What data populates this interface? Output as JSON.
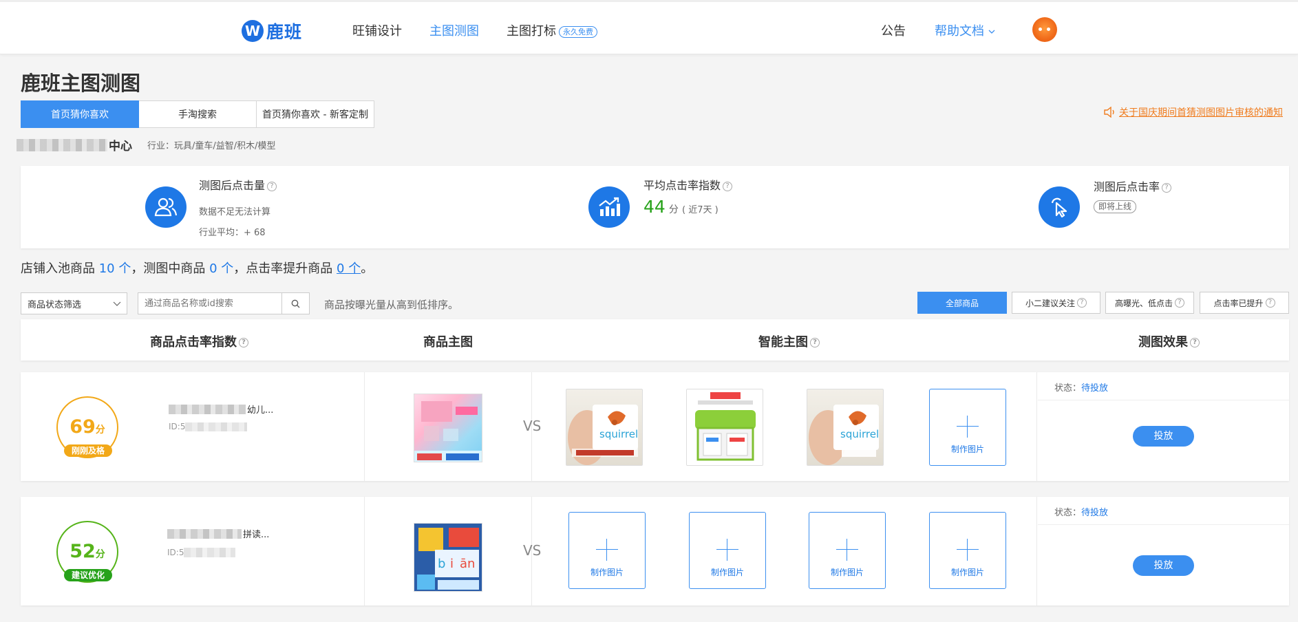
{
  "header": {
    "logo_text": "鹿班",
    "nav": [
      "旺铺设计",
      "主图测图",
      "主图打标"
    ],
    "nav_badge": "永久免费",
    "announcement": "公告",
    "help": "帮助文档"
  },
  "page": {
    "title": "鹿班主图测图",
    "tabs": [
      "首页猜你喜欢",
      "手淘搜索",
      "首页猜你喜欢 - 新客定制"
    ],
    "notice": "关于国庆期间首猜测图图片审核的通知"
  },
  "shop": {
    "name_suffix": "中心",
    "industry": "行业：玩具/童车/益智/积木/模型"
  },
  "stats": [
    {
      "title": "测图后点击量",
      "line1": "数据不足无法计算",
      "line2": "行业平均：+ 68"
    },
    {
      "title": "平均点击率指数",
      "value": "44",
      "unit": "分",
      "note": "( 近7天 )"
    },
    {
      "title": "测图后点击率",
      "tag": "即将上线"
    }
  ],
  "summary": {
    "p1": "店铺入池商品 ",
    "n1": "10 个",
    "p2": "，测图中商品 ",
    "n2": "0 个",
    "p3": "，点击率提升商品 ",
    "n3": "0 个",
    "p4": "。"
  },
  "toolbar": {
    "filter_label": "商品状态筛选",
    "search_placeholder": "通过商品名称或id搜索",
    "sort_text": "商品按曝光量从高到低排序。",
    "filters": [
      "全部商品",
      "小二建议关注",
      "高曝光、低点击",
      "点击率已提升"
    ]
  },
  "table": {
    "headers": [
      "商品点击率指数",
      "商品主图",
      "智能主图",
      "测图效果"
    ],
    "vs": "VS",
    "make_label": "制作图片",
    "status_label": "状态：",
    "deploy_label": "投放",
    "rows": [
      {
        "score": "69",
        "unit": "分",
        "badge": "刚刚及格",
        "name_suffix": "幼儿...",
        "id_prefix": "ID:5",
        "status": "待投放",
        "color": "#f2a818"
      },
      {
        "score": "52",
        "unit": "分",
        "badge": "建议优化",
        "name_suffix": "拼读...",
        "id_prefix": "ID:5",
        "status": "待投放",
        "color": "#56b41a"
      }
    ]
  },
  "colors": {
    "brand": "#3b8ff0",
    "link": "#1e78e6",
    "warn": "#f07c1e",
    "good": "#27a21a"
  }
}
